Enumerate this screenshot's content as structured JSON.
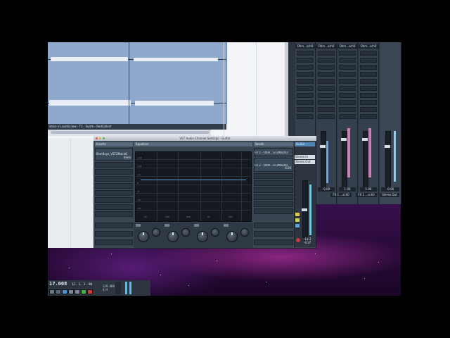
{
  "project": {
    "event_label": "Voice v1.audio.new - T1 - Synth - RedCollect"
  },
  "mixer": {
    "channel_names": [
      "Ohm...sch0",
      "Ohm...sch0",
      "Ohm...sch0",
      "Ohm...sch0"
    ],
    "channel_values": [
      "-0.00",
      "1.00",
      "1.00",
      "-0.00"
    ],
    "bottom_labels": [
      "FX 1 ...sch0",
      "FX 1 ...sch0",
      "Stereo Out"
    ]
  },
  "vst_window": {
    "title": "VST Audio Channel Settings - Guitar",
    "inserts_header": "Inserts",
    "equalizer_header": "Equalizer",
    "sends_header": "Sends",
    "channel_header": "Guitar",
    "insert_1": "OhmBoyz_VST2MachO",
    "insert_1_sub": "Elem",
    "send_1": "FX 1 - Ohm...ST2MachO",
    "send_2": "FX 2 - Ohm...ST2MachO",
    "send_2_value": "0.00",
    "routing_1": "Stereo In",
    "routing_2": "Stereo Out",
    "fader_value": "-13.3",
    "fader_value_2": "-0.37",
    "eq_y_labels": [
      "+24",
      "+18",
      "+12",
      "+6",
      "0",
      "-6",
      "-12",
      "-18",
      "-24"
    ],
    "eq_x_labels": [
      "20",
      "50",
      "100",
      "200",
      "500",
      "1k",
      "2k",
      "5k",
      "10k",
      "20k"
    ]
  },
  "transport": {
    "time_display": "17.008",
    "bars_display": "12. 1. 1. 00",
    "tempo": "120.000",
    "signature": "4/4"
  }
}
